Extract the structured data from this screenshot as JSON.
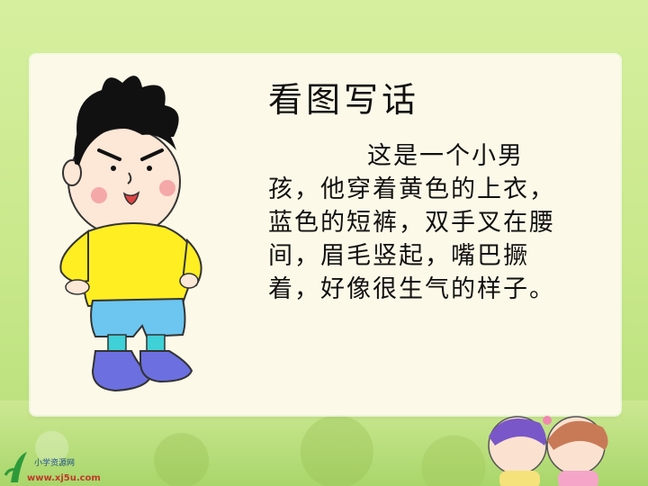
{
  "slide": {
    "title": "看图写话",
    "paragraph": "这是一个小男孩，他穿着黄色的上衣，蓝色的短裤，双手叉在腰间，眉毛竖起，嘴巴撅着，好像很生气的样子。"
  },
  "logo": {
    "name": "小学资源网",
    "url": "www.xj5u.com"
  },
  "colors": {
    "background": "#c8e88a",
    "card": "#fdf9e8",
    "shirt": "#ffee22",
    "shorts": "#6cc6f0",
    "shoes": "#6b6fe0"
  }
}
